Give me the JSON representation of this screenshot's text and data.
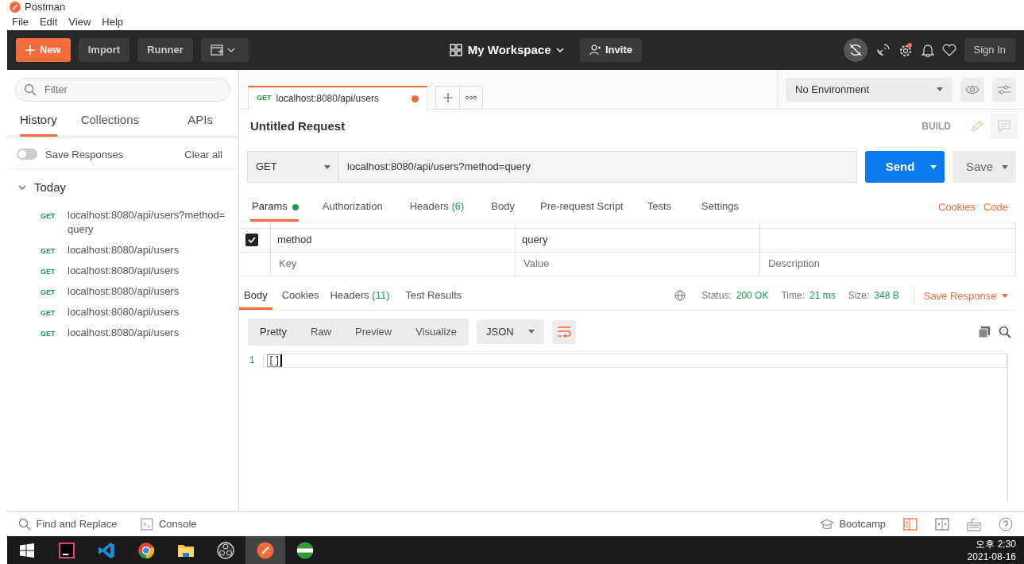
{
  "window": {
    "title": "Postman"
  },
  "menu": [
    "File",
    "Edit",
    "View",
    "Help"
  ],
  "header": {
    "new_button": "New",
    "import_button": "Import",
    "runner_button": "Runner",
    "workspace": "My Workspace",
    "invite_button": "Invite",
    "sign_in_button": "Sign In"
  },
  "sidebar": {
    "filter_placeholder": "Filter",
    "tabs": [
      {
        "label": "History",
        "selected": true
      },
      {
        "label": "Collections",
        "selected": false
      },
      {
        "label": "APIs",
        "selected": false
      }
    ],
    "save_responses": {
      "label": "Save Responses",
      "on": false
    },
    "clear_all": "Clear all",
    "group": {
      "label": "Today",
      "expanded": true,
      "children": [
        {
          "method": "GET",
          "url": "localhost:8080/api/users?method=query"
        },
        {
          "method": "GET",
          "url": "localhost:8080/api/users"
        },
        {
          "method": "GET",
          "url": "localhost:8080/api/users"
        },
        {
          "method": "GET",
          "url": "localhost:8080/api/users"
        },
        {
          "method": "GET",
          "url": "localhost:8080/api/users"
        },
        {
          "method": "GET",
          "url": "localhost:8080/api/users"
        }
      ]
    }
  },
  "request_tab": {
    "method": "GET",
    "url": "localhost:8080/api/users",
    "unsaved": true,
    "selected": true
  },
  "environment": "No Environment",
  "request": {
    "name": "Untitled Request",
    "mode": "BUILD",
    "method": "GET",
    "url": "localhost:8080/api/users?method=query",
    "send_button": "Send",
    "save_button": "Save"
  },
  "request_tabs": [
    {
      "label": "Params",
      "dot": true,
      "selected": true
    },
    {
      "label": "Authorization",
      "dot": false,
      "selected": false
    },
    {
      "label": "Headers",
      "count": "(6)",
      "dot": false,
      "selected": false
    },
    {
      "label": "Body",
      "dot": false,
      "selected": false
    },
    {
      "label": "Pre-request Script",
      "dot": false,
      "selected": false
    },
    {
      "label": "Tests",
      "dot": false,
      "selected": false
    },
    {
      "label": "Settings",
      "dot": false,
      "selected": false
    }
  ],
  "request_links": [
    "Cookies",
    "Code"
  ],
  "params": [
    {
      "checked": true,
      "key": "method",
      "value": "query"
    }
  ],
  "params_new_row": {
    "key_placeholder": "Key",
    "value_placeholder": "Value",
    "description_placeholder": "Description"
  },
  "response": {
    "tabs": [
      {
        "label": "Body",
        "selected": true
      },
      {
        "label": "Cookies",
        "selected": false
      },
      {
        "label": "Headers",
        "count": "(11)",
        "selected": false
      },
      {
        "label": "Test Results",
        "selected": false
      }
    ],
    "status_label": "Status:",
    "status": "200 OK",
    "time_label": "Time:",
    "time": "21 ms",
    "size_label": "Size:",
    "size": "348 B",
    "save_response": "Save Response",
    "view_modes": [
      {
        "label": "Pretty",
        "selected": true
      },
      {
        "label": "Raw",
        "selected": false
      },
      {
        "label": "Preview",
        "selected": false
      },
      {
        "label": "Visualize",
        "selected": false
      }
    ],
    "format": "JSON",
    "lines": [
      {
        "number": "1",
        "text": "[]"
      }
    ]
  },
  "footer": {
    "find_replace": "Find and Replace",
    "console": "Console",
    "bootcamp": "Bootcamp"
  },
  "taskbar": {
    "apps": [
      {
        "kind": "intellij",
        "selected": false
      },
      {
        "kind": "vscode",
        "selected": false
      },
      {
        "kind": "chrome",
        "selected": false
      },
      {
        "kind": "folder",
        "selected": false
      },
      {
        "kind": "obs",
        "selected": false
      },
      {
        "kind": "postman",
        "selected": true
      },
      {
        "kind": "hs",
        "selected": false
      }
    ],
    "time": "오후 2:30",
    "date": "2021-08-16"
  }
}
